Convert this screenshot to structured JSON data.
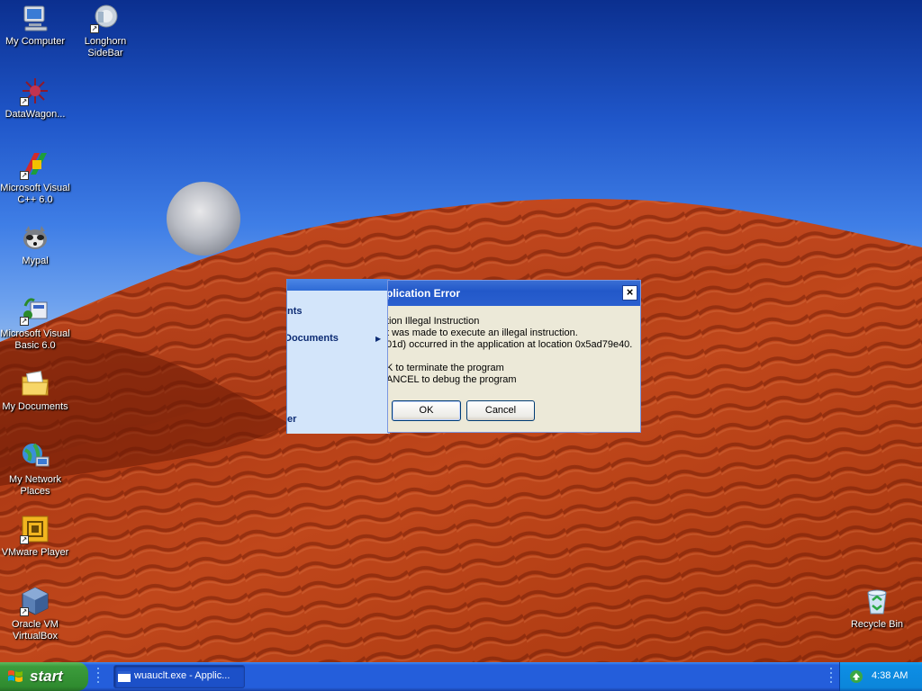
{
  "desktop": {
    "icons": [
      {
        "label": "My Computer",
        "icon": "my-computer-icon"
      },
      {
        "label": "Longhorn SideBar",
        "icon": "sidebar-icon"
      },
      {
        "label": "DataWagon...",
        "icon": "datawagon-icon"
      },
      {
        "label": "Microsoft Visual C++ 6.0",
        "icon": "visual-cpp-icon"
      },
      {
        "label": "Mypal",
        "icon": "mypal-icon"
      },
      {
        "label": "Microsoft Visual Basic 6.0",
        "icon": "visual-basic-icon"
      },
      {
        "label": "My Documents",
        "icon": "my-documents-icon"
      },
      {
        "label": "My Network Places",
        "icon": "network-places-icon"
      },
      {
        "label": "VMware Player",
        "icon": "vmware-icon"
      },
      {
        "label": "Oracle VM VirtualBox",
        "icon": "virtualbox-icon"
      },
      {
        "label": "Recycle Bin",
        "icon": "recycle-bin-icon"
      }
    ]
  },
  "start_menu_remnant": {
    "items": [
      "nts",
      "Documents",
      "er"
    ]
  },
  "dialog": {
    "title": "plication Error",
    "message": "tion Illegal Instruction\nt was made to execute an illegal instruction.\n01d) occurred in the application at location 0x5ad79e40.\n\nK to terminate the program\nANCEL to debug the program",
    "ok_label": "OK",
    "cancel_label": "Cancel",
    "close_glyph": "×"
  },
  "taskbar": {
    "start_label": "start",
    "task_label": "wuauclt.exe - Applic...",
    "clock": "4:38 AM"
  }
}
